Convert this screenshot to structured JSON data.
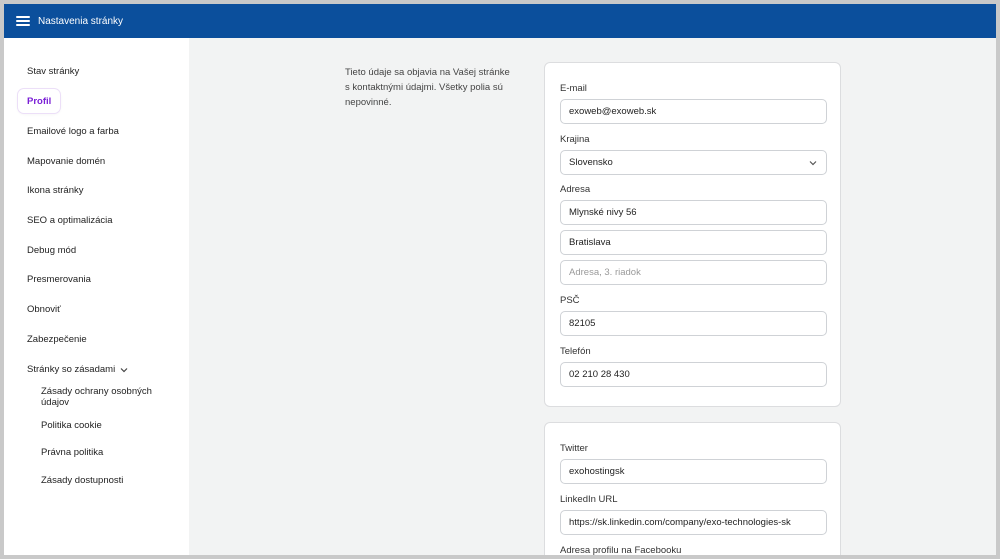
{
  "topbar": {
    "title": "Nastavenia stránky"
  },
  "sidebar": {
    "items": [
      {
        "label": "Stav stránky"
      },
      {
        "label": "Profil"
      },
      {
        "label": "Emailové logo a farba"
      },
      {
        "label": "Mapovanie domén"
      },
      {
        "label": "Ikona stránky"
      },
      {
        "label": "SEO a optimalizácia"
      },
      {
        "label": "Debug mód"
      },
      {
        "label": "Presmerovania"
      },
      {
        "label": "Obnoviť"
      },
      {
        "label": "Zabezpečenie"
      },
      {
        "label": "Stránky so zásadami"
      }
    ],
    "active": "Profil",
    "subitems": [
      {
        "label": "Zásady ochrany osobných údajov"
      },
      {
        "label": "Politika cookie"
      },
      {
        "label": "Právna politika"
      },
      {
        "label": "Zásady dostupnosti"
      }
    ]
  },
  "main": {
    "description": "Tieto údaje sa objavia na Vašej stránke s kontaktnými údajmi. Všetky polia sú nepovinné.",
    "contact": {
      "email_label": "E-mail",
      "email_value": "exoweb@exoweb.sk",
      "country_label": "Krajina",
      "country_value": "Slovensko",
      "address_label": "Adresa",
      "address_line1": "Mlynské nivy 56",
      "address_line2": "Bratislava",
      "address_line3_placeholder": "Adresa, 3. riadok",
      "zip_label": "PSČ",
      "zip_value": "82105",
      "phone_label": "Telefón",
      "phone_value": "02 210 28 430"
    },
    "social": {
      "twitter_label": "Twitter",
      "twitter_value": "exohostingsk",
      "linkedin_label": "LinkedIn URL",
      "linkedin_value": "https://sk.linkedin.com/company/exo-technologies-sk",
      "facebook_label": "Adresa profilu na Facebooku"
    }
  },
  "colors": {
    "topbar": "#0b4f9c",
    "active_nav": "#7a1fd6",
    "background": "#f2f3f3"
  }
}
